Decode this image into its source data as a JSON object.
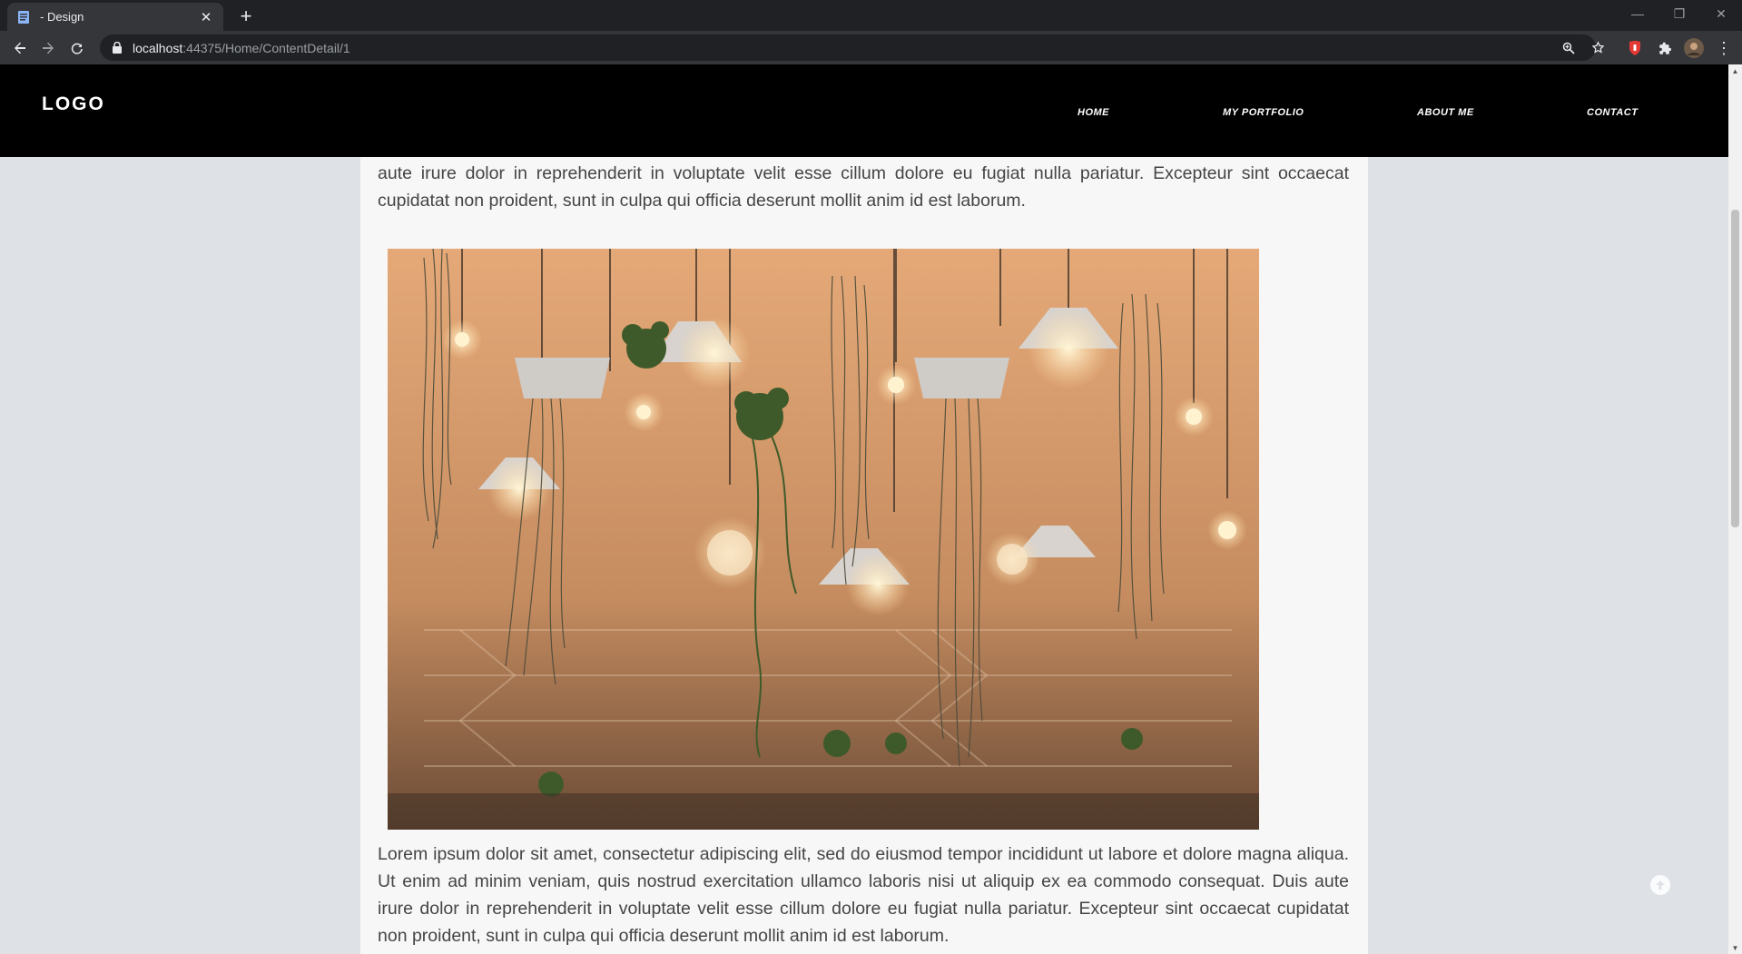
{
  "browser": {
    "tab_title": "- Design",
    "tab_close": "✕",
    "new_tab": "+",
    "url_host": "localhost",
    "url_rest": ":44375/Home/ContentDetail/1",
    "window_controls": {
      "minimize": "—",
      "restore": "❐",
      "close": "✕"
    }
  },
  "site": {
    "logo": "LOGO",
    "nav": [
      {
        "label": "HOME"
      },
      {
        "label": "MY PORTFOLIO"
      },
      {
        "label": "ABOUT ME"
      },
      {
        "label": "CONTACT"
      }
    ]
  },
  "article": {
    "paragraph_top": "aliqua. Ut enim ad minim veniam, quis nostrud exercitation ullamco laboris nisi ut aliquip ex ea commodo consequat. Duis aute irure dolor in reprehenderit in voluptate velit esse cillum dolore eu fugiat nulla pariatur. Excepteur sint occaecat cupidatat non proident, sunt in culpa qui officia deserunt mollit anim id est laborum.",
    "image_subject": "hanging plants and light bulbs",
    "paragraph_bottom": "Lorem ipsum dolor sit amet, consectetur adipiscing elit, sed do eiusmod tempor incididunt ut labore et dolore magna aliqua. Ut enim ad minim veniam, quis nostrud exercitation ullamco laboris nisi ut aliquip ex ea commodo consequat. Duis aute irure dolor in reprehenderit in voluptate velit esse cillum dolore eu fugiat nulla pariatur. Excepteur sint occaecat cupidatat non proident, sunt in culpa qui officia deserunt mollit anim id est laborum."
  },
  "colors": {
    "page_bg": "#dee2e6",
    "content_bg": "#f7f7f7",
    "header_bg": "#000000",
    "browser_dark": "#202124"
  },
  "icons": [
    "page-icon",
    "close-icon",
    "plus-icon",
    "back-icon",
    "forward-icon",
    "reload-icon",
    "lock-icon",
    "zoom-icon",
    "star-icon",
    "extension-icon",
    "puzzle-icon",
    "avatar",
    "more-icon",
    "arrow-up-icon"
  ]
}
